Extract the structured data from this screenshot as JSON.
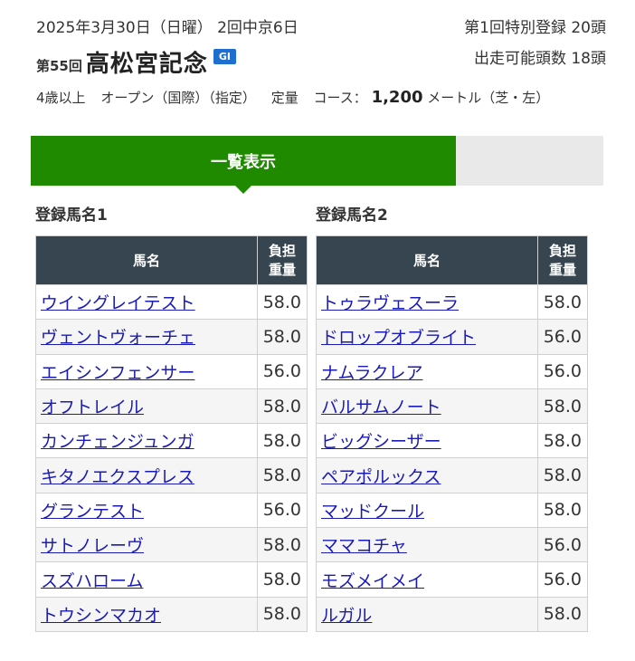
{
  "race": {
    "date_line": "2025年3月30日（日曜）  2回中京6日",
    "number": "第55回",
    "name": "高松宮記念",
    "grade": "GI",
    "conditions": [
      "4歳以上",
      "オープン（国際）（指定）",
      "定量"
    ],
    "course_label": "コース：",
    "distance": "1,200",
    "distance_unit": "メートル（芝・左）",
    "registration": "第1回特別登録 20頭",
    "runners": "出走可能頭数  18頭"
  },
  "tabs": {
    "active": "一覧表示"
  },
  "list1": {
    "title": "登録馬名1",
    "header_name": "馬名",
    "header_weight_1": "負担",
    "header_weight_2": "重量",
    "rows": [
      {
        "name": "ウイングレイテスト",
        "weight": "58.0"
      },
      {
        "name": "ヴェントヴォーチェ",
        "weight": "58.0"
      },
      {
        "name": "エイシンフェンサー",
        "weight": "56.0"
      },
      {
        "name": "オフトレイル",
        "weight": "58.0"
      },
      {
        "name": "カンチェンジュンガ",
        "weight": "58.0"
      },
      {
        "name": "キタノエクスプレス",
        "weight": "58.0"
      },
      {
        "name": "グランテスト",
        "weight": "56.0"
      },
      {
        "name": "サトノレーヴ",
        "weight": "58.0"
      },
      {
        "name": "スズハローム",
        "weight": "58.0"
      },
      {
        "name": "トウシンマカオ",
        "weight": "58.0"
      }
    ]
  },
  "list2": {
    "title": "登録馬名2",
    "header_name": "馬名",
    "header_weight_1": "負担",
    "header_weight_2": "重量",
    "rows": [
      {
        "name": "トゥラヴェスーラ",
        "weight": "58.0"
      },
      {
        "name": "ドロップオブライト",
        "weight": "56.0"
      },
      {
        "name": "ナムラクレア",
        "weight": "56.0"
      },
      {
        "name": "バルサムノート",
        "weight": "58.0"
      },
      {
        "name": "ビッグシーザー",
        "weight": "58.0"
      },
      {
        "name": "ペアポルックス",
        "weight": "58.0"
      },
      {
        "name": "マッドクール",
        "weight": "58.0"
      },
      {
        "name": "ママコチャ",
        "weight": "56.0"
      },
      {
        "name": "モズメイメイ",
        "weight": "56.0"
      },
      {
        "name": "ルガル",
        "weight": "58.0"
      }
    ]
  },
  "colors": {
    "accent": "#1f8a00",
    "header_bg": "#36454f",
    "link": "#1a1ab4",
    "grade": "#1f6fd1"
  }
}
